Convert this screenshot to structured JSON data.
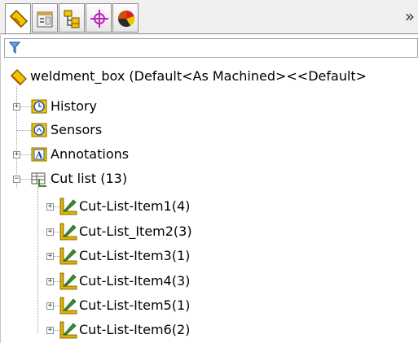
{
  "tabs": [
    {
      "name": "featuremanager-tab-icon"
    },
    {
      "name": "propertymanager-tab-icon"
    },
    {
      "name": "configurationmanager-tab-icon"
    },
    {
      "name": "dimxpert-tab-icon"
    },
    {
      "name": "display-manager-tab-icon"
    }
  ],
  "more_tabs_glyph": "»",
  "root": {
    "label": "weldment_box  (Default<As Machined><<Default>"
  },
  "tree": {
    "history": "History",
    "sensors": "Sensors",
    "annotations": "Annotations",
    "cutlist": "Cut list (13)",
    "items": [
      "Cut-List-Item1(4)",
      "Cut-List_Item2(3)",
      "Cut-List-Item3(1)",
      "Cut-List-Item4(3)",
      "Cut-List-Item5(1)",
      "Cut-List-Item6(2)"
    ]
  },
  "colors": {
    "accent_blue": "#2b5db8",
    "weld_yellow": "#e0b100",
    "weld_green": "#3c8c28"
  }
}
